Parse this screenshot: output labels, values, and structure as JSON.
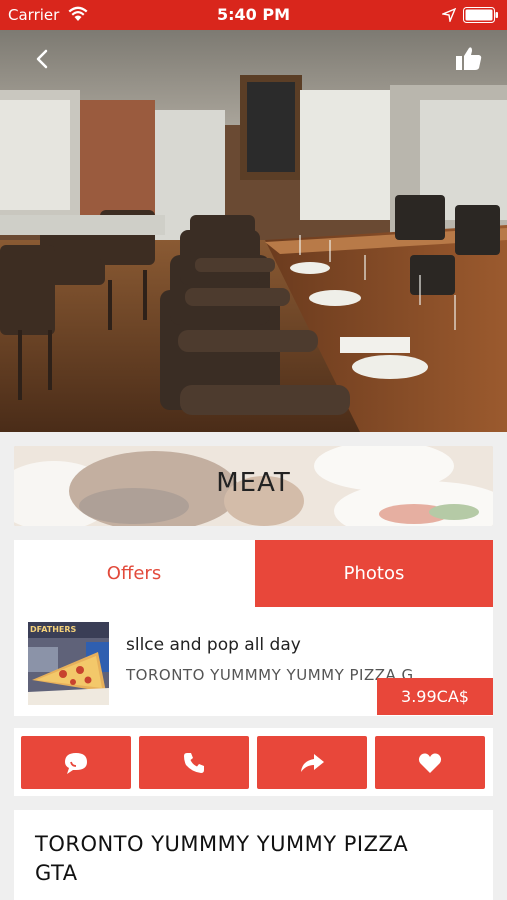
{
  "status_bar": {
    "carrier": "Carrier",
    "time": "5:40 PM",
    "wifi_icon": "wifi-icon",
    "location_icon": "location-arrow-icon",
    "battery_icon": "battery-icon"
  },
  "header": {
    "back_icon": "chevron-left-icon",
    "like_icon": "thumbs-up-icon"
  },
  "category": {
    "label": "MEAT"
  },
  "tabs": [
    {
      "label": "Offers",
      "active": false
    },
    {
      "label": "Photos",
      "active": true
    }
  ],
  "offer": {
    "title": "sllce and pop all day",
    "subtitle": "TORONTO YUMMMY YUMMY PIZZA G",
    "price": "3.99CA$",
    "thumb_sign_text": "DFATHERS"
  },
  "actions": [
    {
      "name": "chat",
      "icon": "chat-bubble-icon"
    },
    {
      "name": "call",
      "icon": "phone-icon"
    },
    {
      "name": "share",
      "icon": "share-arrow-icon"
    },
    {
      "name": "favorite",
      "icon": "heart-icon"
    }
  ],
  "info": {
    "title": "TORONTO YUMMMY YUMMY PIZZA GTA"
  },
  "colors": {
    "brand_red": "#e8473a",
    "status_bar_red": "#d9261c"
  }
}
